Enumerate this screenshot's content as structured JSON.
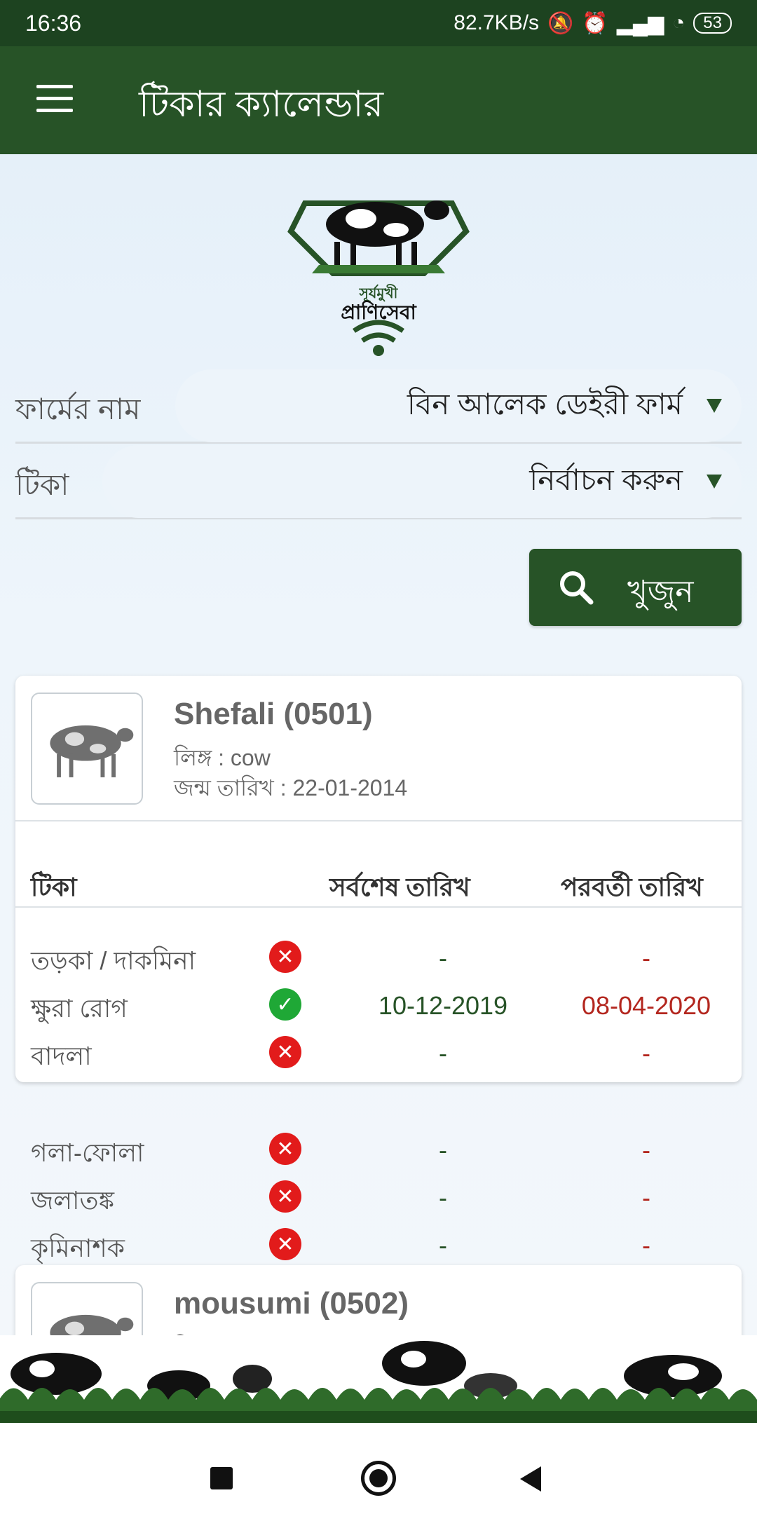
{
  "status_bar": {
    "time": "16:36",
    "speed": "82.7KB/s",
    "battery": "53"
  },
  "app_bar": {
    "title": "টিকার ক্যালেন্ডার"
  },
  "logo": {
    "line1": "সূর্যমুখী",
    "line2": "প্রাণিসেবা"
  },
  "form": {
    "farm_label": "ফার্মের নাম",
    "farm_value": "বিন আলেক ডেইরী ফার্ম",
    "vaccine_label": "টিকা",
    "vaccine_value": "নির্বাচন করুন",
    "search_label": "খুজুন"
  },
  "table_headers": {
    "vaccine": "টিকা",
    "last_date": "সর্বশেষ তারিখ",
    "next_date": "পরবর্তী তারিখ"
  },
  "animals": [
    {
      "name": "Shefali (0501)",
      "sex": "লিঙ্গ : cow",
      "dob": "জন্ম তারিখ :  22-01-2014",
      "vaccines": [
        {
          "name": "তড়কা / দাকমিনা",
          "done": false,
          "last": "-",
          "next": "-"
        },
        {
          "name": "ক্ষুরা রোগ",
          "done": true,
          "last": "10-12-2019",
          "next": "08-04-2020"
        },
        {
          "name": "বাদলা",
          "done": false,
          "last": "-",
          "next": "-"
        },
        {
          "name": "গলা-ফোলা",
          "done": false,
          "last": "-",
          "next": "-"
        },
        {
          "name": "জলাতঙ্ক",
          "done": false,
          "last": "-",
          "next": "-"
        },
        {
          "name": "কৃমিনাশক",
          "done": false,
          "last": "-",
          "next": "-"
        }
      ]
    },
    {
      "name": "mousumi (0502)",
      "sex": "লিঙ্গ : cow"
    }
  ],
  "colors": {
    "primary": "#275327",
    "status_bar": "#1d4320",
    "next_date": "#b3261e",
    "missing": "#e21b1b",
    "done": "#1fa836"
  }
}
